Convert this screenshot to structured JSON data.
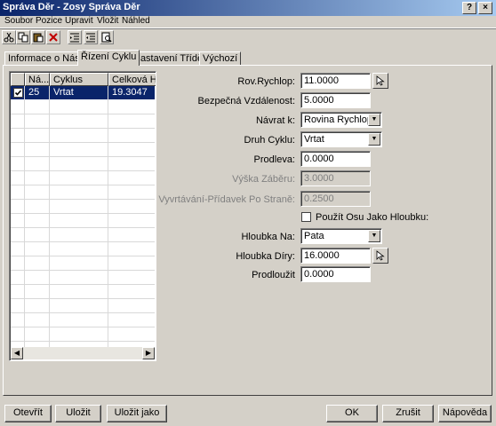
{
  "window": {
    "title": "Správa Děr - Zosy Správa Děr"
  },
  "title_buttons": {
    "help": "?",
    "close": "×"
  },
  "menu": [
    "Soubor",
    "Pozice",
    "Upravit",
    "Vložit",
    "Náhled"
  ],
  "toolbar": {
    "icons": [
      "cut-icon",
      "copy-icon",
      "paste-icon",
      "delete-icon",
      "indent-in-icon",
      "indent-out-icon",
      "preview-icon"
    ]
  },
  "tabs": [
    {
      "label": "Informace o Nástroji",
      "active": false
    },
    {
      "label": "Řízení Cyklu",
      "active": true
    },
    {
      "label": "Nastavení Třídění",
      "active": false
    },
    {
      "label": "Výchozí",
      "active": false
    }
  ],
  "list": {
    "columns": [
      "Ná...",
      "Cyklus",
      "Celková Hlo"
    ],
    "rows": [
      {
        "checked": true,
        "n": "25",
        "cycle": "Vrtat",
        "depth": "19.3047",
        "selected": true
      }
    ]
  },
  "form": {
    "rov_rychlop": {
      "label": "Rov.Rychlop:",
      "value": "11.0000"
    },
    "bezpecna": {
      "label": "Bezpečná Vzdálenost:",
      "value": "5.0000"
    },
    "navrat": {
      "label": "Návrat k:",
      "value": "Rovina Rychlop."
    },
    "druh_cyklu": {
      "label": "Druh Cyklu:",
      "value": "Vrtat"
    },
    "prodleva": {
      "label": "Prodleva:",
      "value": "0.0000"
    },
    "vyska_zaberu": {
      "label": "Výška Záběru:",
      "value": "3.0000"
    },
    "vyvrtavani": {
      "label": "Vyvrtávání-Přídavek Po Straně:",
      "value": "0.2500"
    },
    "pouzit_osu": {
      "label": "Použít Osu Jako Hloubku:",
      "checked": false
    },
    "hloubka_na": {
      "label": "Hloubka Na:",
      "value": "Pata"
    },
    "hloubka_diry": {
      "label": "Hloubka Díry:",
      "value": "16.0000"
    },
    "prodlouzit": {
      "label": "Prodloužit",
      "value": "0.0000"
    }
  },
  "buttons": {
    "open": "Otevřít",
    "save": "Uložit",
    "save_as": "Uložit jako",
    "ok": "OK",
    "cancel": "Zrušit",
    "help": "Nápověda"
  }
}
